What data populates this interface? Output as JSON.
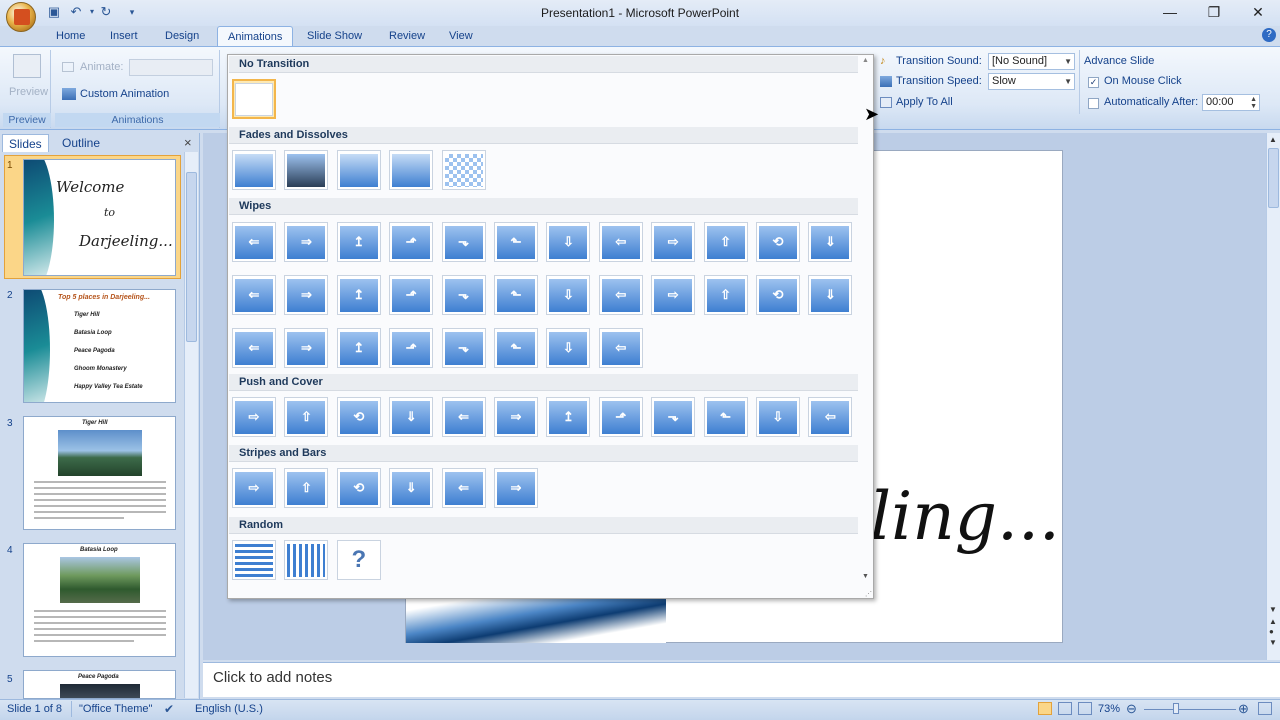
{
  "titlebar": {
    "title": "Presentation1 - Microsoft PowerPoint",
    "qat": [
      "save-icon",
      "undo-icon",
      "dropdown-arrow-icon",
      "redo-icon",
      "customize-icon"
    ],
    "window_buttons": {
      "minimize": "—",
      "restore": "❐",
      "close": "✕"
    }
  },
  "tabs": [
    "Home",
    "Insert",
    "Design",
    "Animations",
    "Slide Show",
    "Review",
    "View"
  ],
  "active_tab": "Animations",
  "ribbon": {
    "preview_label": "Preview",
    "preview_group": "Preview",
    "animate_label": "Animate:",
    "custom_animation": "Custom Animation",
    "animations_group": "Animations",
    "transition_sound_label": "Transition Sound:",
    "transition_sound_value": "[No Sound]",
    "transition_speed_label": "Transition Speed:",
    "transition_speed_value": "Slow",
    "apply_to_all": "Apply To All",
    "advance_slide": "Advance Slide",
    "on_mouse_click": "On Mouse Click",
    "on_mouse_click_checked": true,
    "automatically_after": "Automatically After:",
    "automatically_after_checked": false,
    "auto_time": "00:00"
  },
  "left_panel": {
    "tabs": [
      "Slides",
      "Outline"
    ],
    "close": "×",
    "slides": [
      {
        "num": "1",
        "title": "Welcome",
        "line2": "to",
        "line3": "Darjeeling..."
      },
      {
        "num": "2",
        "title": "Top 5 places in Darjeeling...",
        "bullets": [
          "Tiger Hill",
          "Batasia Loop",
          "Peace Pagoda",
          "Ghoom Monastery",
          "Happy Valley Tea Estate"
        ]
      },
      {
        "num": "3",
        "title": "Tiger Hill"
      },
      {
        "num": "4",
        "title": "Batasia Loop"
      },
      {
        "num": "5",
        "title": "Peace Pagoda"
      }
    ]
  },
  "slide": {
    "text": "ling..."
  },
  "notes": {
    "placeholder": "Click to add notes"
  },
  "status": {
    "slide_of": "Slide 1 of 8",
    "theme": "\"Office Theme\"",
    "language": "English (U.S.)",
    "zoom": "73%"
  },
  "gallery": {
    "sections": [
      {
        "name": "No Transition",
        "count": 1
      },
      {
        "name": "Fades and Dissolves",
        "count": 5
      },
      {
        "name": "Wipes",
        "count": 32
      },
      {
        "name": "Push and Cover",
        "count": 12
      },
      {
        "name": "Stripes and Bars",
        "count": 6
      },
      {
        "name": "Random",
        "count": 3
      }
    ]
  },
  "colors": {
    "ribbon_bg": "#dde8f6",
    "accent": "#15428b",
    "selected": "#f3b64b",
    "transition_blue": "#3e7fd1"
  }
}
